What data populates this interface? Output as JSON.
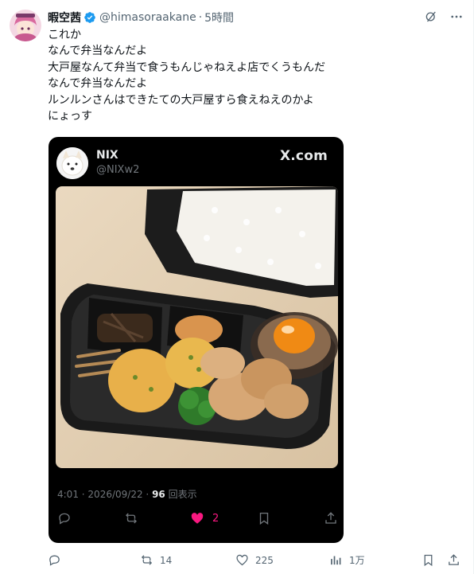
{
  "author": {
    "display_name": "暇空茜",
    "handle": "@himasoraakane",
    "time": "5時間",
    "avatar_icon": "user-avatar"
  },
  "tweet_lines": [
    "これか",
    "なんで弁当なんだよ",
    "大戸屋なんて弁当で食うもんじゃねえよ店でくうもんだ",
    "なんで弁当なんだよ",
    "ルンルンさんはできたての大戸屋すら食えねえのかよ",
    "にょっす"
  ],
  "quoted_card": {
    "name": "NIX",
    "handle": "@NIXw2",
    "brand": "X.com",
    "photo_icon": "bento-photo",
    "time": "4:01",
    "date": "2026/09/22",
    "views_number": "96",
    "views_label": "回表示",
    "likes": "2"
  },
  "actions": {
    "retweets": "14",
    "likes": "225",
    "views": "1万"
  },
  "colors": {
    "verified": "#1d9bf0",
    "like_pink": "#f91880",
    "card_bg": "#000000",
    "muted": "#536471"
  }
}
